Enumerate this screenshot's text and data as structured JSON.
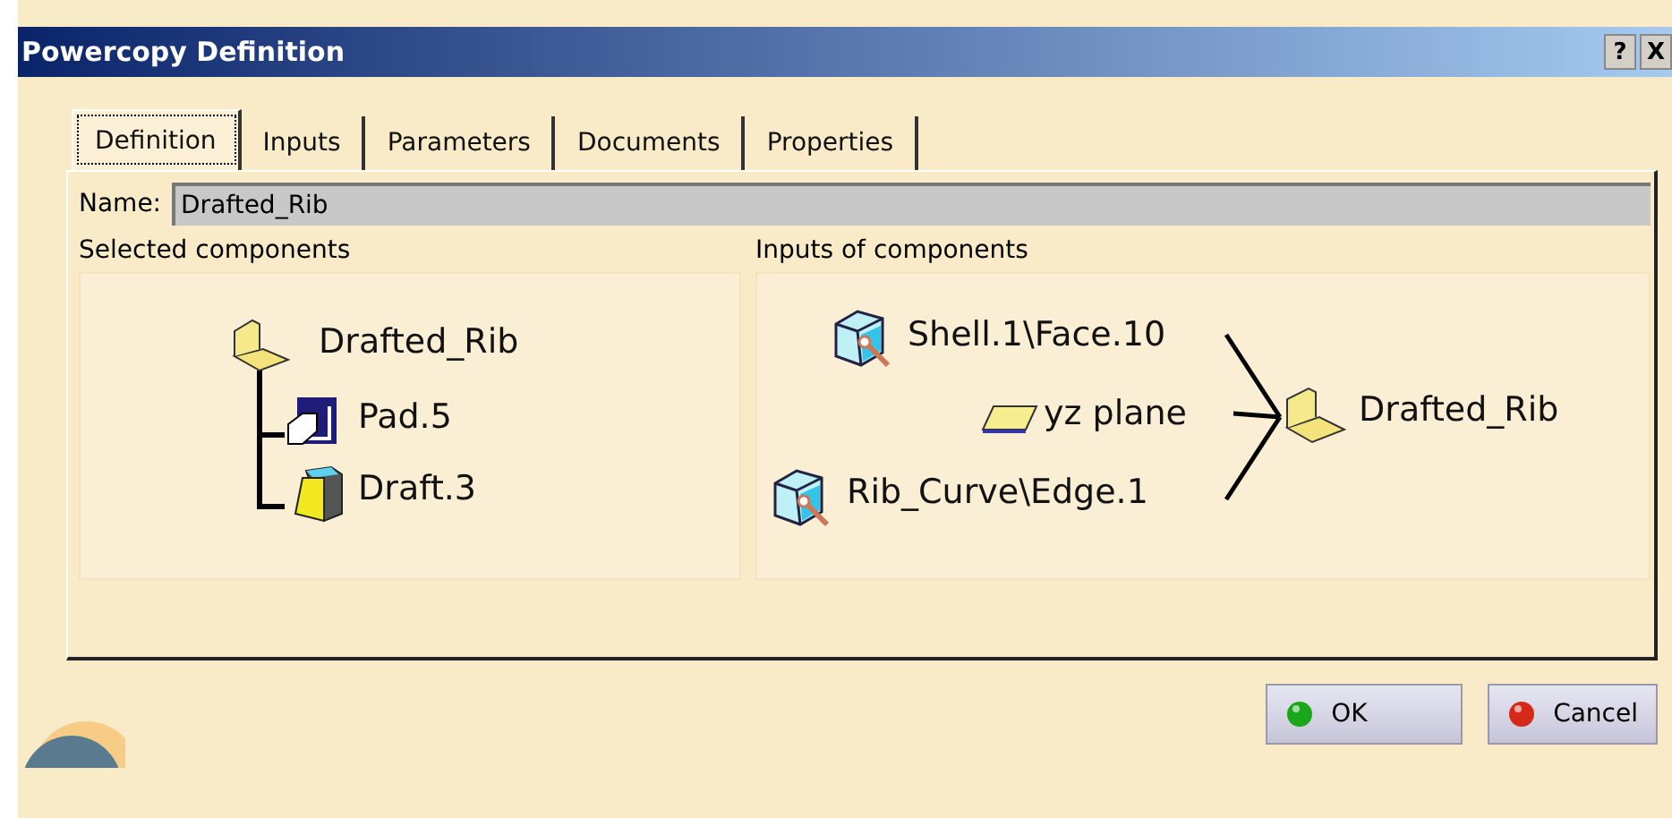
{
  "window": {
    "title": "Powercopy Definition",
    "help": "?",
    "close": "X"
  },
  "tabs": [
    {
      "label": "Definition",
      "selected": true
    },
    {
      "label": "Inputs",
      "selected": false
    },
    {
      "label": "Parameters",
      "selected": false
    },
    {
      "label": "Documents",
      "selected": false
    },
    {
      "label": "Properties",
      "selected": false
    }
  ],
  "name_field": {
    "label": "Name:",
    "value": "Drafted_Rib"
  },
  "selected_components": {
    "heading": "Selected components",
    "tree": {
      "label": "Drafted_Rib",
      "children": [
        {
          "label": "Pad.5",
          "kind": "pad"
        },
        {
          "label": "Draft.3",
          "kind": "draft"
        }
      ]
    }
  },
  "inputs_of_components": {
    "heading": "Inputs of components",
    "inputs": [
      {
        "label": "Shell.1\\Face.10",
        "kind": "reference"
      },
      {
        "label": "yz plane",
        "kind": "plane"
      },
      {
        "label": "Rib_Curve\\Edge.1",
        "kind": "reference"
      }
    ],
    "output": "Drafted_Rib"
  },
  "buttons": [
    {
      "label": "OK",
      "kind": "ok"
    },
    {
      "label": "Cancel",
      "kind": "cancel"
    }
  ]
}
